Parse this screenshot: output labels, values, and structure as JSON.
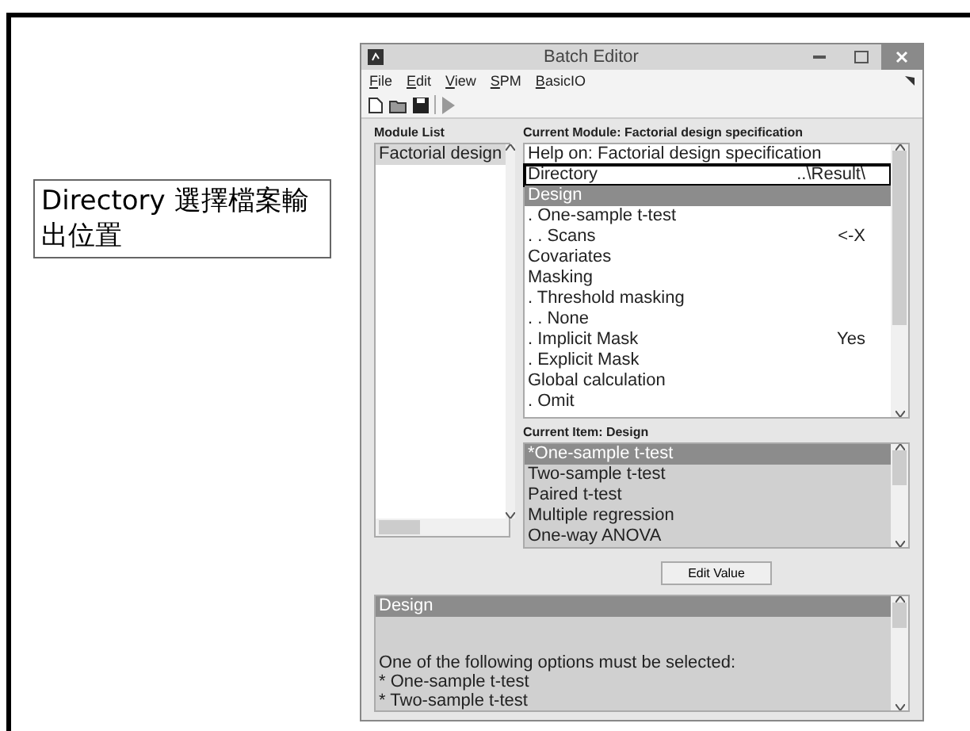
{
  "callout": {
    "text": "Directory 選擇檔案輸出位置"
  },
  "window": {
    "title": "Batch Editor"
  },
  "menu": [
    "File",
    "Edit",
    "View",
    "SPM",
    "BasicIO"
  ],
  "module_list": {
    "label": "Module List",
    "items": [
      {
        "label": "Factorial design",
        "selected": true
      }
    ]
  },
  "current_module": {
    "label": "Current Module: Factorial design specification",
    "items": [
      {
        "label": "Help on: Factorial design specification",
        "value": "",
        "selected": false,
        "highlighted": false
      },
      {
        "label": "Directory",
        "value": "..\\Result\\",
        "selected": false,
        "highlighted": true
      },
      {
        "label": "Design",
        "value": "",
        "selected": true,
        "highlighted": false
      },
      {
        "label": ". One-sample t-test",
        "value": "",
        "selected": false,
        "highlighted": false
      },
      {
        "label": ". . Scans",
        "value": "<-X",
        "selected": false,
        "highlighted": false
      },
      {
        "label": "Covariates",
        "value": "",
        "selected": false,
        "highlighted": false
      },
      {
        "label": "Masking",
        "value": "",
        "selected": false,
        "highlighted": false
      },
      {
        "label": ". Threshold masking",
        "value": "",
        "selected": false,
        "highlighted": false
      },
      {
        "label": ". . None",
        "value": "",
        "selected": false,
        "highlighted": false
      },
      {
        "label": ". Implicit Mask",
        "value": "Yes",
        "selected": false,
        "highlighted": false
      },
      {
        "label": ". Explicit Mask",
        "value": "",
        "selected": false,
        "highlighted": false
      },
      {
        "label": "Global calculation",
        "value": "",
        "selected": false,
        "highlighted": false
      },
      {
        "label": ". Omit",
        "value": "",
        "selected": false,
        "highlighted": false
      }
    ]
  },
  "current_item": {
    "label": "Current Item: Design",
    "options": [
      {
        "label": "*One-sample t-test",
        "selected": true
      },
      {
        "label": "Two-sample t-test",
        "selected": false
      },
      {
        "label": "Paired t-test",
        "selected": false
      },
      {
        "label": "Multiple regression",
        "selected": false
      },
      {
        "label": "One-way ANOVA",
        "selected": false
      }
    ]
  },
  "edit_button": "Edit Value",
  "help": {
    "title": "Design",
    "lines": [
      "One of the following options must be selected:",
      "* One-sample t-test",
      "* Two-sample t-test"
    ]
  }
}
